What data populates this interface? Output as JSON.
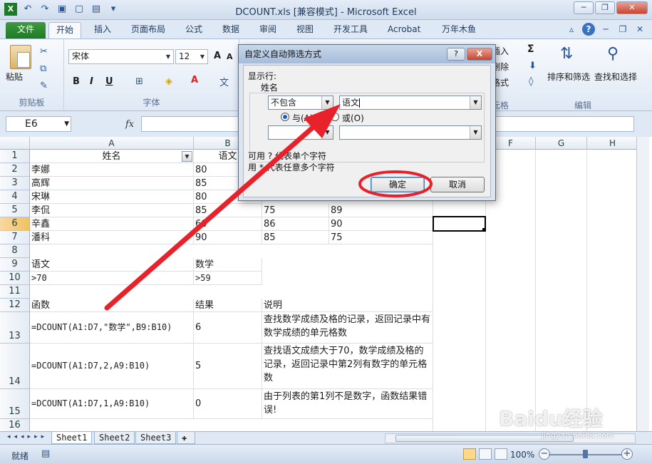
{
  "window": {
    "title": "DCOUNT.xls  [兼容模式] - Microsoft Excel"
  },
  "ribbon_tabs": [
    "文件",
    "开始",
    "插入",
    "页面布局",
    "公式",
    "数据",
    "审阅",
    "视图",
    "开发工具",
    "Acrobat",
    "万年木鱼"
  ],
  "ribbon": {
    "paste_label": "粘贴",
    "clipboard_label": "剪贴板",
    "font_name": "宋体",
    "font_size": "12",
    "font_group_label": "字体",
    "bold": "B",
    "italic": "I",
    "underline": "U",
    "insert_label": "插入",
    "delete_label": "删除",
    "format_label": "格式",
    "cells_label": "元格",
    "sort_filter_label": "排序和筛选",
    "find_select_label": "查找和选择",
    "edit_label": "编辑",
    "sigma": "Σ"
  },
  "formula_bar": {
    "name_box": "E6",
    "fx": "fx",
    "formula": ""
  },
  "columns": [
    "A",
    "B",
    "C",
    "D",
    "E",
    "F",
    "G",
    "H"
  ],
  "rows": [
    "1",
    "2",
    "3",
    "4",
    "5",
    "6",
    "7",
    "8",
    "9",
    "10",
    "11",
    "12",
    "13",
    "14",
    "15",
    "16"
  ],
  "cells": {
    "A1": "姓名",
    "B1": "语文",
    "A2": "李娜",
    "B2": "80",
    "A3": "高辉",
    "B3": "85",
    "A4": "宋琳",
    "B4": "80",
    "A5": "李侃",
    "B5": "85",
    "C5": "75",
    "D5": "89",
    "A6": "辛鑫",
    "B6": "60",
    "C6": "86",
    "D6": "90",
    "A7": "潘科",
    "B7": "90",
    "C7": "85",
    "D7": "75",
    "A9": "语文",
    "B9": "数学",
    "A10": ">70",
    "B10": ">59",
    "A12": "函数",
    "B12": "结果",
    "C12": "说明",
    "A13": "=DCOUNT(A1:D7,\"数学\",B9:B10)",
    "B13": "6",
    "C13": "查找数学成绩及格的记录，返回记录中有数学成绩的单元格数",
    "A14": "=DCOUNT(A1:D7,2,A9:B10)",
    "B14": "5",
    "C14": "查找语文成绩大于70，数学成绩及格的记录，返回记录中第2列有数字的单元格数",
    "A15": "=DCOUNT(A1:D7,1,A9:B10)",
    "B15": "0",
    "C15": "由于列表的第1列不是数字，函数结果错误!"
  },
  "sheet_tabs": [
    "Sheet1",
    "Sheet2",
    "Sheet3"
  ],
  "status": {
    "ready": "就绪",
    "zoom": "100%"
  },
  "dialog": {
    "title": "自定义自动筛选方式",
    "show_rows": "显示行:",
    "field": "姓名",
    "op1": "不包含",
    "val1": "语文",
    "and_label": "与(A)",
    "or_label": "或(O)",
    "op2": "",
    "val2": "",
    "hint1": "可用 ? 代表单个字符",
    "hint2": "用 * 代表任意多个字符",
    "ok": "确定",
    "cancel": "取消",
    "help": "?",
    "close": "X"
  },
  "watermark": {
    "brand": "Baidu经验",
    "url": "jingyan.baidu.com"
  },
  "colors": {
    "annotation_red": "#e8222a",
    "file_tab_green": "#1d7a26",
    "active_header": "#f1c15f"
  }
}
